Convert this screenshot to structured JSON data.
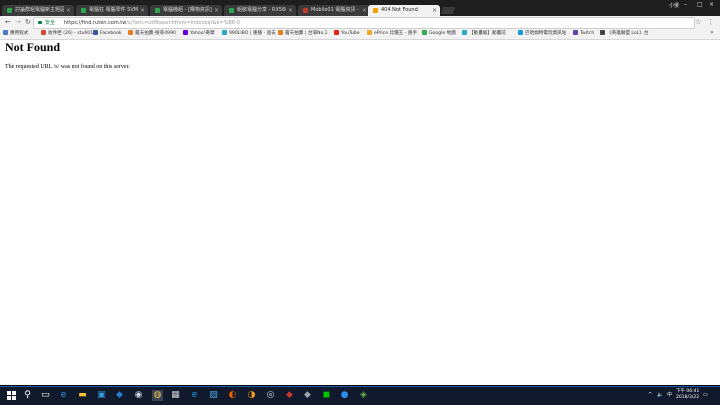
{
  "browser": {
    "tabs": [
      {
        "title": "討論群組電腦新主題區 小",
        "active": false,
        "favicon_color": "#2ea44f"
      },
      {
        "title": "電腦狂 電腦零件 SVM 小",
        "active": false,
        "favicon_color": "#2ea44f"
      },
      {
        "title": "電腦機組 - [購物資訊] 小",
        "active": false,
        "favicon_color": "#2ea44f"
      },
      {
        "title": "組裝電腦分享 - RX560 小",
        "active": false,
        "favicon_color": "#2ea44f"
      },
      {
        "title": "Mobile01 電腦資訊 - 小",
        "active": false,
        "favicon_color": "#c0392b"
      },
      {
        "title": "404 Not Found",
        "active": true,
        "favicon_color": "#f0a000"
      }
    ],
    "user_label": "小僂",
    "window_controls": {
      "minimize": "–",
      "maximize": "□",
      "close": "×"
    },
    "secure_label": "安全",
    "url_main": "https://find.ruten.com.tw",
    "url_rest": "/s/?enc=utf8searchfrom=indexbar&k=%B8-0",
    "bookmarks": [
      {
        "label": "應用程式",
        "color": "#4a78c8"
      },
      {
        "label": "收件匣 (26) - stu6012",
        "color": "#d44638"
      },
      {
        "label": "Facebook",
        "color": "#3b5998"
      },
      {
        "label": "露天拍賣-搜尋4990",
        "color": "#e67e22"
      },
      {
        "label": "Yahoo!奇摩",
        "color": "#6001d2"
      },
      {
        "label": "990LIBO | 重播 - 過去",
        "color": "#2aa8c5"
      },
      {
        "label": "露天拍賣 | 台灣No.1",
        "color": "#e67e22"
      },
      {
        "label": "YouTube",
        "color": "#e62117"
      },
      {
        "label": "ePrice 比價王 - 買手",
        "color": "#f5a623"
      },
      {
        "label": "Google 地圖",
        "color": "#34a853"
      },
      {
        "label": "【動畫瘋】動畫前",
        "color": "#29a9c2"
      },
      {
        "label": "巴哈姆特電玩資訊站",
        "color": "#1e9bd7"
      },
      {
        "label": "Twitch",
        "color": "#6441a5"
      },
      {
        "label": "《英雄聯盟 LoL》台",
        "color": "#444444"
      }
    ]
  },
  "page": {
    "heading": "Not Found",
    "message": "The requested URL /s/ was not found on this server."
  },
  "taskbar": {
    "apps": [
      {
        "name": "search-icon",
        "glyph": "⚲",
        "color": "#ffffff"
      },
      {
        "name": "task-view-icon",
        "glyph": "▭",
        "color": "#ffffff"
      },
      {
        "name": "edge-icon",
        "glyph": "e",
        "color": "#3a96dd"
      },
      {
        "name": "file-explorer-icon",
        "glyph": "▬",
        "color": "#f4c430"
      },
      {
        "name": "store-icon",
        "glyph": "▣",
        "color": "#3a96dd"
      },
      {
        "name": "app-icon-blue",
        "glyph": "◆",
        "color": "#2a7bd4"
      },
      {
        "name": "steam-icon",
        "glyph": "◉",
        "color": "#c7d5e0"
      },
      {
        "name": "chrome-icon",
        "glyph": "◍",
        "color": "#e8c547"
      },
      {
        "name": "calculator-icon",
        "glyph": "▦",
        "color": "#cfcfcf"
      },
      {
        "name": "ie-icon",
        "glyph": "e",
        "color": "#1ea1f1"
      },
      {
        "name": "photos-icon",
        "glyph": "▨",
        "color": "#4aa3df"
      },
      {
        "name": "firefox-icon",
        "glyph": "◐",
        "color": "#e66000"
      },
      {
        "name": "app-icon-orange",
        "glyph": "◑",
        "color": "#f39c12"
      },
      {
        "name": "obs-icon",
        "glyph": "◎",
        "color": "#d0d0d0"
      },
      {
        "name": "app-icon-red",
        "glyph": "◆",
        "color": "#c0392b"
      },
      {
        "name": "app-icon-grey",
        "glyph": "◆",
        "color": "#9aa0a6"
      },
      {
        "name": "line-icon",
        "glyph": "◼",
        "color": "#00c300"
      },
      {
        "name": "app-icon-blue-2",
        "glyph": "●",
        "color": "#2d8cf0"
      },
      {
        "name": "app-icon-green",
        "glyph": "◈",
        "color": "#6ab04c"
      }
    ],
    "tray": {
      "chevron": "^",
      "volume": "🔈",
      "ime": "中",
      "time": "下午 06:41",
      "date": "2018/3/22",
      "notifications": "▭"
    }
  }
}
